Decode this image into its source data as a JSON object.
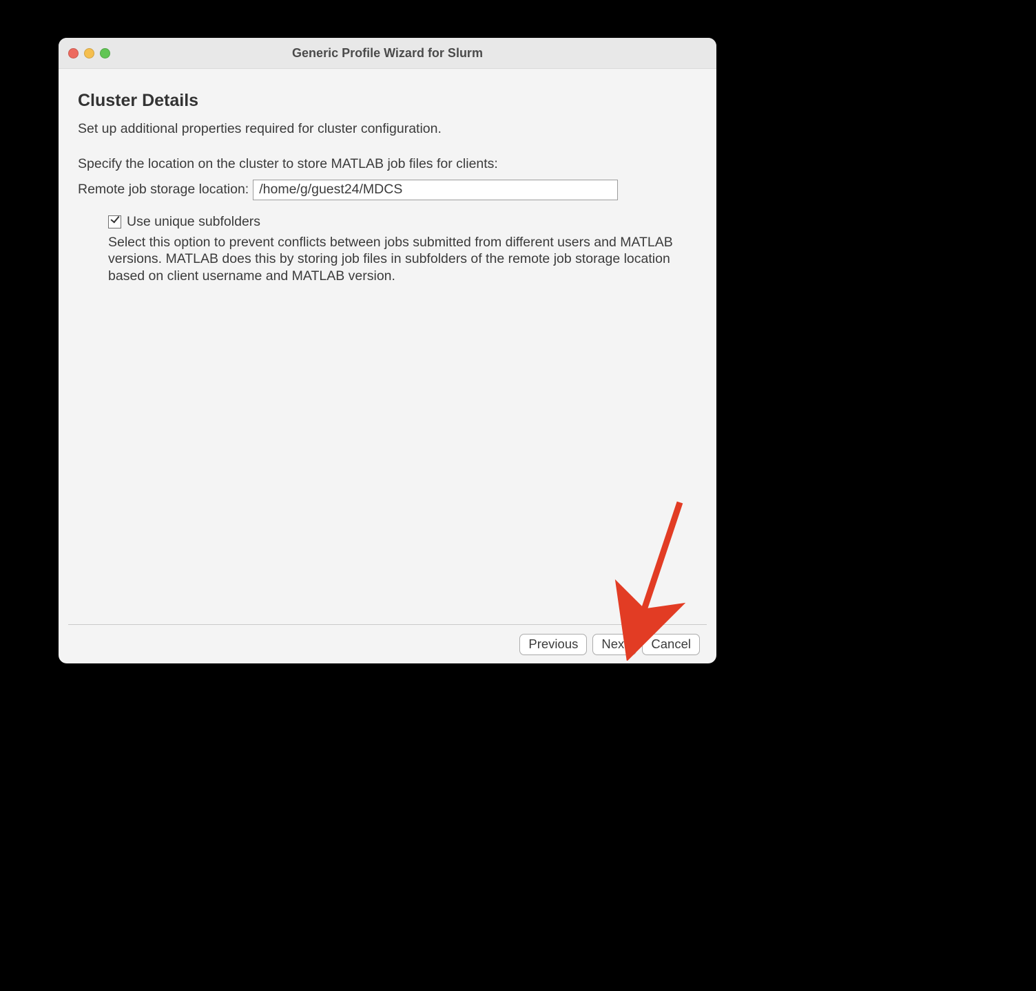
{
  "window": {
    "title": "Generic Profile Wizard for Slurm"
  },
  "page": {
    "heading": "Cluster Details",
    "intro": "Set up additional properties required for cluster configuration.",
    "location_prompt": "Specify the location on the cluster to store MATLAB job files for clients:",
    "location_label": "Remote job storage location:",
    "location_value": "/home/g/guest24/MDCS",
    "subfolders_label": "Use unique subfolders",
    "subfolders_checked": true,
    "subfolders_desc": "Select this option to prevent conflicts between jobs submitted from different users and MATLAB versions. MATLAB does this by storing job files in subfolders of the remote job storage location based on client username and MATLAB version."
  },
  "footer": {
    "previous": "Previous",
    "next": "Next",
    "cancel": "Cancel"
  },
  "annotation": {
    "arrow_target": "next-button",
    "arrow_color": "#e23c24"
  }
}
